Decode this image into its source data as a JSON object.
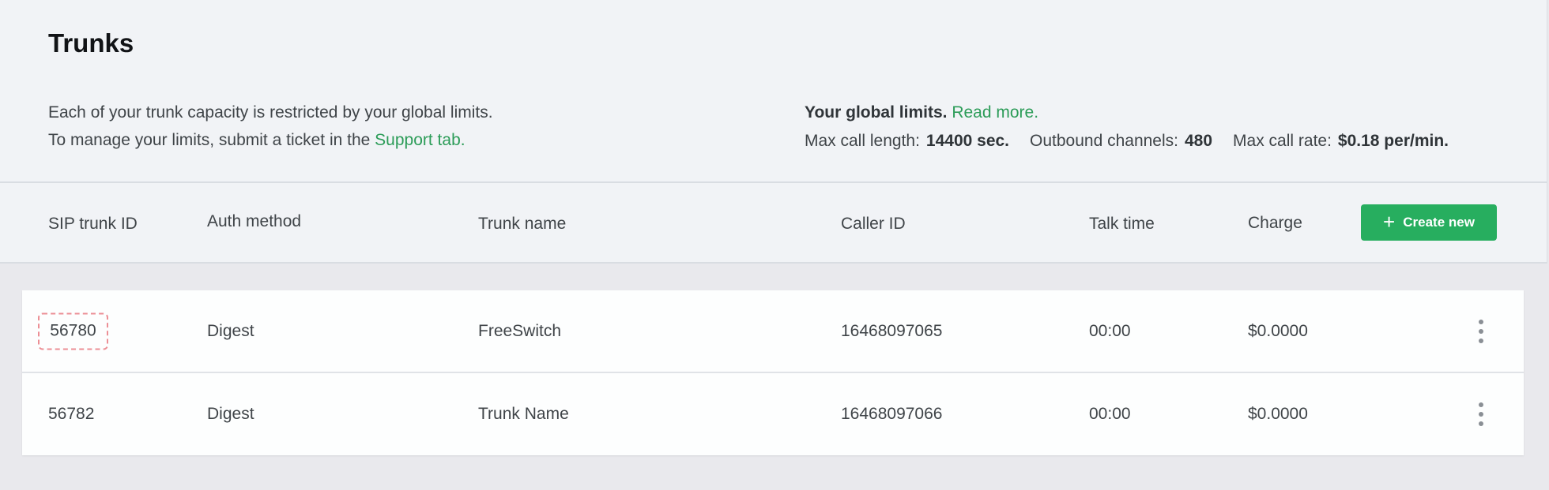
{
  "page": {
    "title": "Trunks"
  },
  "info": {
    "line1": "Each of your trunk capacity is restricted by your global limits.",
    "line2_prefix": "To manage your limits, submit a ticket in the ",
    "support_link": "Support tab."
  },
  "limits": {
    "title": "Your global limits.",
    "read_more": "Read more.",
    "max_call_length_label": "Max call length:",
    "max_call_length_value": "14400 sec.",
    "outbound_channels_label": "Outbound channels:",
    "outbound_channels_value": "480",
    "max_call_rate_label": "Max call rate:",
    "max_call_rate_value": "$0.18 per/min."
  },
  "table": {
    "columns": [
      "SIP trunk ID",
      "Auth method",
      "Trunk name",
      "Caller ID",
      "Talk time",
      "Charge"
    ],
    "create_label": "Create new",
    "rows": [
      {
        "id": "56780",
        "auth": "Digest",
        "name": "FreeSwitch",
        "caller_id": "16468097065",
        "talk_time": "00:00",
        "charge": "$0.0000"
      },
      {
        "id": "56782",
        "auth": "Digest",
        "name": "Trunk Name",
        "caller_id": "16468097066",
        "talk_time": "00:00",
        "charge": "$0.0000"
      }
    ]
  },
  "colors": {
    "accent": "#27ae5f",
    "link": "#2c9c58",
    "selection": "#ec8f95"
  },
  "icons": {
    "create": "plus-icon",
    "row_menu": "kebab-menu-icon"
  }
}
